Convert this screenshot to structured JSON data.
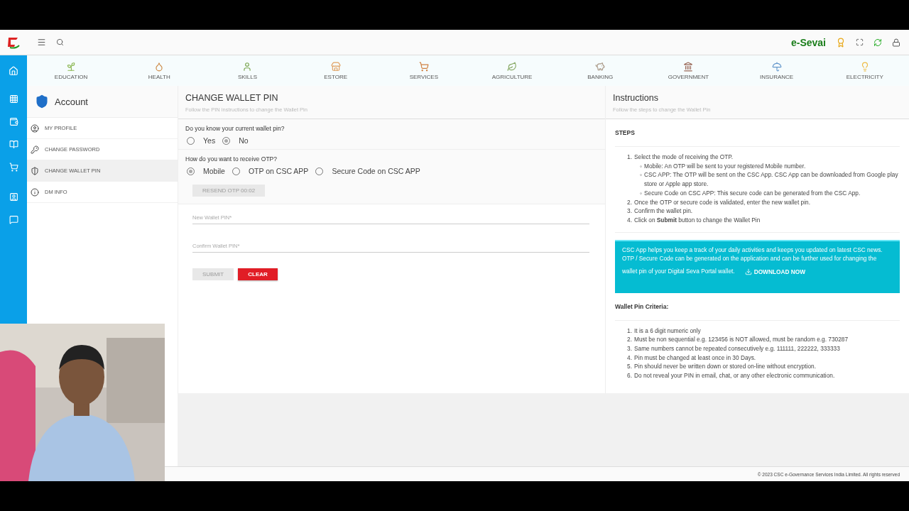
{
  "topbar": {
    "brand": "e-Sevai"
  },
  "categories": [
    {
      "label": "EDUCATION",
      "kind": "education"
    },
    {
      "label": "HEALTH",
      "kind": "health"
    },
    {
      "label": "SKILLS",
      "kind": "skills"
    },
    {
      "label": "ESTORE",
      "kind": "estore"
    },
    {
      "label": "SERVICES",
      "kind": "services"
    },
    {
      "label": "AGRICULTURE",
      "kind": "agriculture"
    },
    {
      "label": "BANKING",
      "kind": "banking"
    },
    {
      "label": "GOVERNMENT",
      "kind": "government"
    },
    {
      "label": "INSURANCE",
      "kind": "insurance"
    },
    {
      "label": "ELECTRICITY",
      "kind": "electricity"
    }
  ],
  "sidebar": {
    "title": "Account",
    "items": [
      {
        "label": "MY PROFILE",
        "kind": "profile",
        "selected": false
      },
      {
        "label": "CHANGE PASSWORD",
        "kind": "key",
        "selected": false
      },
      {
        "label": "CHANGE WALLET PIN",
        "kind": "shield",
        "selected": true
      },
      {
        "label": "DM INFO",
        "kind": "info",
        "selected": false
      }
    ]
  },
  "form": {
    "title": "CHANGE WALLET PIN",
    "subtitle": "Follow the PIN instructions to change the Wallet Pin",
    "question_1": "Do you know your current wallet pin?",
    "options_1": [
      {
        "label": "Yes",
        "selected": false
      },
      {
        "label": "No",
        "selected": true
      }
    ],
    "question_2": "How do you want to receive OTP?",
    "options_2": [
      {
        "label": "Mobile",
        "selected": true
      },
      {
        "label": "OTP on CSC APP",
        "selected": false
      },
      {
        "label": "Secure Code on CSC APP",
        "selected": false
      }
    ],
    "resend_button": {
      "label": "RESEND OTP 00:02",
      "disabled": true
    },
    "fields": [
      {
        "placeholder": "New Wallet PIN*"
      },
      {
        "placeholder": "Confirm Wallet PIN*"
      }
    ],
    "submit_button": {
      "label": "SUBMIT",
      "disabled": true
    },
    "clear_button": {
      "label": "CLEAR"
    }
  },
  "instructions": {
    "title": "Instructions",
    "subtitle": "Follow the steps to change the Wallet Pin",
    "steps_heading": "STEPS",
    "steps": [
      {
        "marker": "1.",
        "text": "Select the mode of receiving the OTP.",
        "children": [
          {
            "marker": "◦",
            "text": "Mobile: An OTP will be sent to your registered Mobile number."
          },
          {
            "marker": "◦",
            "text": "CSC APP: The OTP will be sent on the CSC App. CSC App can be downloaded from Google play store or Apple app store."
          },
          {
            "marker": "◦",
            "text": "Secure Code on CSC APP: This secure code can be generated from the CSC App."
          }
        ]
      },
      {
        "marker": "2.",
        "text": "Once the OTP or secure code is validated, enter the new wallet pin."
      },
      {
        "marker": "3.",
        "text": "Confirm the wallet pin."
      },
      {
        "marker": "4.",
        "text": "Click on **Submit** button to change the Wallet Pin"
      }
    ],
    "banner": {
      "text": "CSC App helps you keep a track of your daily activities and keeps you updated on latest CSC news. OTP / Secure Code can be generated on the application and can be further used for changing the",
      "text_2": "wallet pin of your Digital Seva Portal wallet.",
      "link": "DOWNLOAD NOW"
    },
    "criteria_heading": "Wallet Pin Criteria:",
    "criteria": [
      {
        "marker": "1.",
        "text": "It is a 6 digit numeric only"
      },
      {
        "marker": "2.",
        "text": "Must be non sequential e.g. 123456 is NOT allowed, must be random e.g. 730287"
      },
      {
        "marker": "3.",
        "text": "Same numbers cannot be repeated consecutively e.g. 111111, 222222, 333333"
      },
      {
        "marker": "4.",
        "text": "Pin must be changed at least once in 30 Days."
      },
      {
        "marker": "5.",
        "text": "Pin should never be written down or stored on-line without encryption."
      },
      {
        "marker": "6.",
        "text": "Do not reveal your PIN in email, chat, or any other electronic communication."
      }
    ]
  },
  "footer": "© 2023 CSC e-Governance Services India Limited. All rights reserved"
}
